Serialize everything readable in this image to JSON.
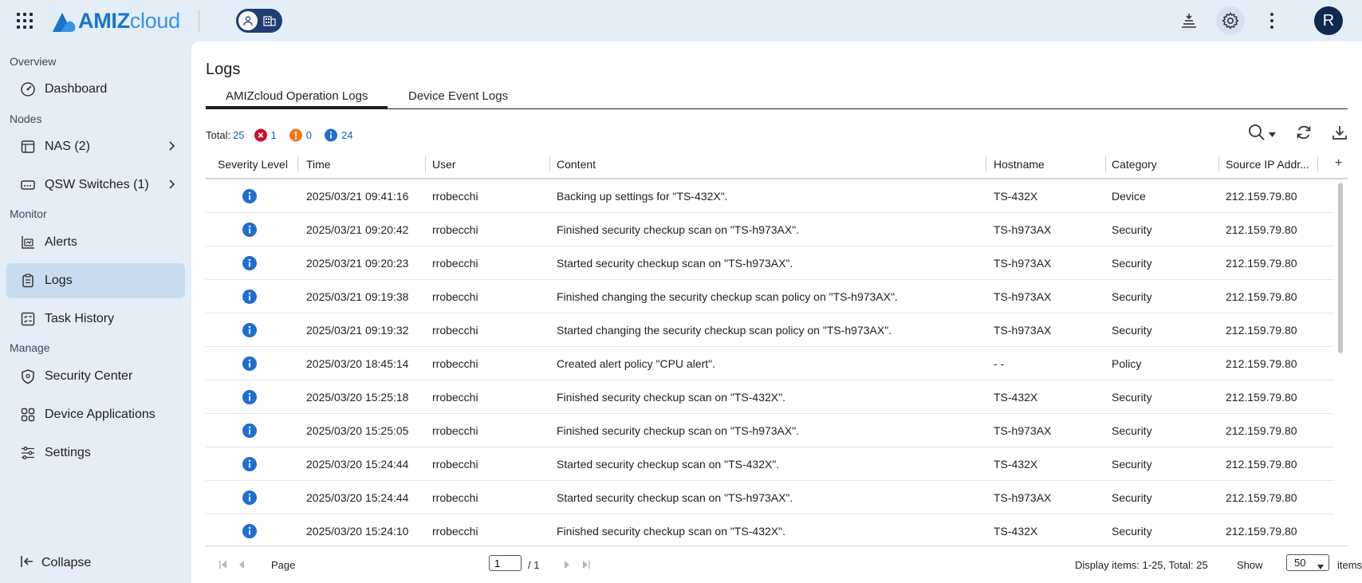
{
  "brand": {
    "name_part1": "AMIZ",
    "name_part2": "cloud"
  },
  "sidebar": {
    "sections": {
      "overview": "Overview",
      "nodes": "Nodes",
      "monitor": "Monitor",
      "manage": "Manage"
    },
    "items": [
      {
        "label": "Dashboard"
      },
      {
        "label": "NAS (2)"
      },
      {
        "label": "QSW Switches (1)"
      },
      {
        "label": "Alerts"
      },
      {
        "label": "Logs"
      },
      {
        "label": "Task History"
      },
      {
        "label": "Security Center"
      },
      {
        "label": "Device Applications"
      },
      {
        "label": "Settings"
      }
    ],
    "collapse": "Collapse"
  },
  "user": {
    "avatar_initial": "R"
  },
  "page": {
    "title": "Logs",
    "tabs": [
      {
        "label": "AMIZcloud Operation Logs",
        "active": true
      },
      {
        "label": "Device Event Logs",
        "active": false
      }
    ]
  },
  "summary": {
    "total_label": "Total:",
    "total": "25",
    "error": "1",
    "warning": "0",
    "info": "24"
  },
  "table": {
    "columns": [
      "Severity Level",
      "Time",
      "User",
      "Content",
      "Hostname",
      "Category",
      "Source IP Addr..."
    ],
    "add_column": "+",
    "rows": [
      {
        "severity": "info",
        "time": "2025/03/21 09:41:16",
        "user": "rrobecchi",
        "content": "Backing up settings for \"TS-432X\".",
        "hostname": "TS-432X",
        "category": "Device",
        "ip": "212.159.79.80"
      },
      {
        "severity": "info",
        "time": "2025/03/21 09:20:42",
        "user": "rrobecchi",
        "content": "Finished security checkup scan on \"TS-h973AX\".",
        "hostname": "TS-h973AX",
        "category": "Security",
        "ip": "212.159.79.80"
      },
      {
        "severity": "info",
        "time": "2025/03/21 09:20:23",
        "user": "rrobecchi",
        "content": "Started security checkup scan on \"TS-h973AX\".",
        "hostname": "TS-h973AX",
        "category": "Security",
        "ip": "212.159.79.80"
      },
      {
        "severity": "info",
        "time": "2025/03/21 09:19:38",
        "user": "rrobecchi",
        "content": "Finished changing the security checkup scan policy on \"TS-h973AX\".",
        "hostname": "TS-h973AX",
        "category": "Security",
        "ip": "212.159.79.80"
      },
      {
        "severity": "info",
        "time": "2025/03/21 09:19:32",
        "user": "rrobecchi",
        "content": "Started changing the security checkup scan policy on \"TS-h973AX\".",
        "hostname": "TS-h973AX",
        "category": "Security",
        "ip": "212.159.79.80"
      },
      {
        "severity": "info",
        "time": "2025/03/20 18:45:14",
        "user": "rrobecchi",
        "content": "Created alert policy \"CPU alert\".",
        "hostname": "- -",
        "category": "Policy",
        "ip": "212.159.79.80"
      },
      {
        "severity": "info",
        "time": "2025/03/20 15:25:18",
        "user": "rrobecchi",
        "content": "Finished security checkup scan on \"TS-432X\".",
        "hostname": "TS-432X",
        "category": "Security",
        "ip": "212.159.79.80"
      },
      {
        "severity": "info",
        "time": "2025/03/20 15:25:05",
        "user": "rrobecchi",
        "content": "Finished security checkup scan on \"TS-h973AX\".",
        "hostname": "TS-h973AX",
        "category": "Security",
        "ip": "212.159.79.80"
      },
      {
        "severity": "info",
        "time": "2025/03/20 15:24:44",
        "user": "rrobecchi",
        "content": "Started security checkup scan on \"TS-432X\".",
        "hostname": "TS-432X",
        "category": "Security",
        "ip": "212.159.79.80"
      },
      {
        "severity": "info",
        "time": "2025/03/20 15:24:44",
        "user": "rrobecchi",
        "content": "Started security checkup scan on \"TS-h973AX\".",
        "hostname": "TS-h973AX",
        "category": "Security",
        "ip": "212.159.79.80"
      },
      {
        "severity": "info",
        "time": "2025/03/20 15:24:10",
        "user": "rrobecchi",
        "content": "Finished security checkup scan on \"TS-432X\".",
        "hostname": "TS-432X",
        "category": "Security",
        "ip": "212.159.79.80"
      }
    ]
  },
  "pagination": {
    "page_label": "Page",
    "page_value": "1",
    "page_total": "/ 1",
    "display_text": "Display items: 1-25, Total: 25",
    "show_label": "Show",
    "per_page": "50",
    "items_label": "items"
  },
  "colors": {
    "accent": "#1a73c9",
    "info": "#1e6fd0",
    "error": "#c8102e",
    "warning": "#f07a1a",
    "nav_active": "#c9dcef",
    "avatar": "#10294d"
  }
}
